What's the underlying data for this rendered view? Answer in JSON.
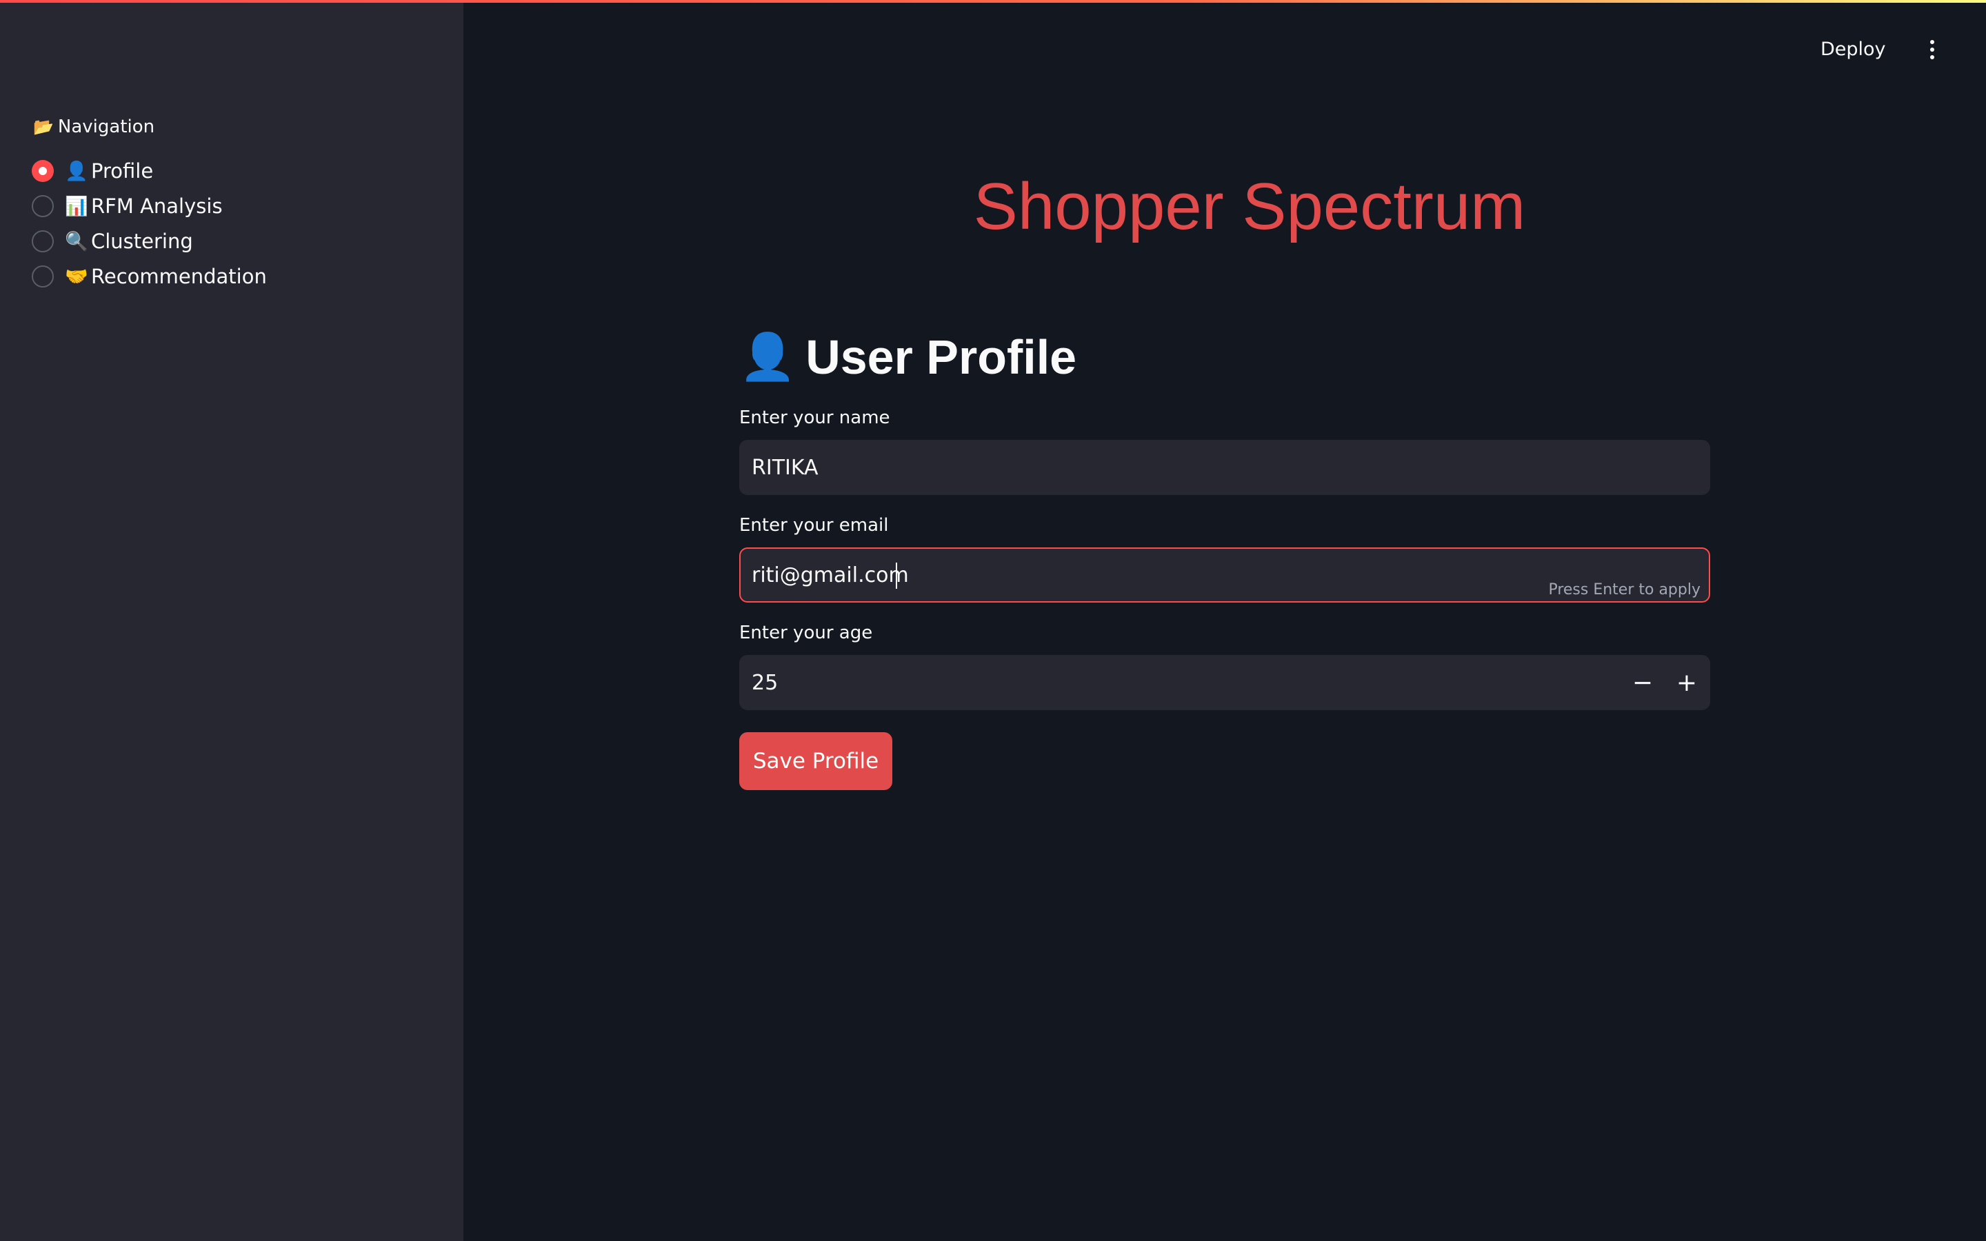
{
  "header": {
    "deploy_label": "Deploy",
    "menu_icon": "more-vertical-icon"
  },
  "sidebar": {
    "nav_icon": "📂",
    "nav_title": "Navigation",
    "items": [
      {
        "icon": "👤",
        "label": "Profile",
        "selected": true
      },
      {
        "icon": "📊",
        "label": "RFM Analysis",
        "selected": false
      },
      {
        "icon": "🔍",
        "label": "Clustering",
        "selected": false
      },
      {
        "icon": "🤝",
        "label": "Recommendation",
        "selected": false
      }
    ]
  },
  "main": {
    "app_title": "Shopper Spectrum",
    "section_icon": "👤",
    "section_title": "User Profile",
    "name_label": "Enter your name",
    "name_value": "RITIKA",
    "email_label": "Enter your email",
    "email_value": "riti@gmail.com",
    "email_hint": "Press Enter to apply",
    "age_label": "Enter your age",
    "age_value": "25",
    "minus": "−",
    "plus": "+",
    "save_label": "Save Profile"
  },
  "colors": {
    "accent": "#ff4b4b",
    "title": "#e14b4b",
    "background": "#131720",
    "sidebar": "#262730"
  }
}
